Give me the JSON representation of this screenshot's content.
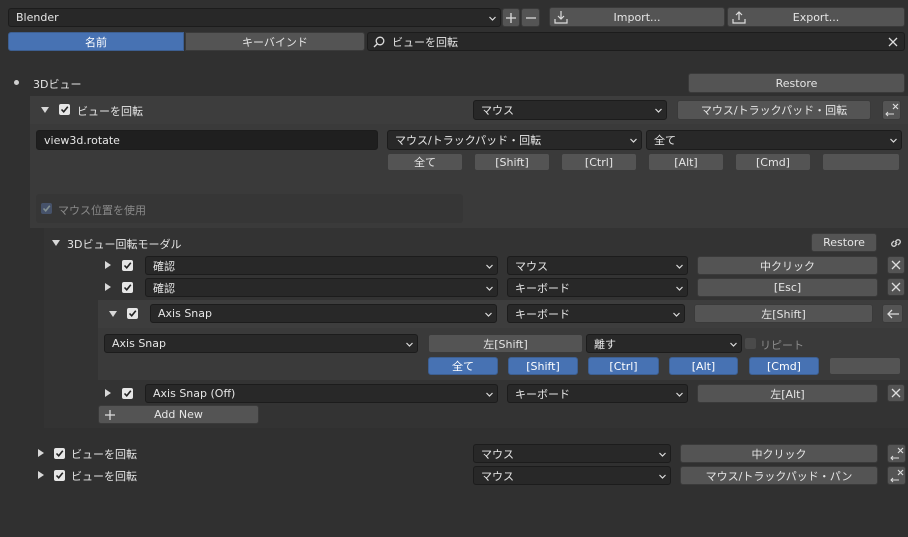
{
  "header": {
    "preset_value": "Blender",
    "import_label": "Import...",
    "export_label": "Export...",
    "tab_name": "名前",
    "tab_keybind": "キーバインド",
    "search_value": "ビューを回転"
  },
  "section": {
    "title": "3Dビュー",
    "restore_label": "Restore"
  },
  "item1": {
    "label": "ビューを回転",
    "type": "マウス",
    "event": "マウス/トラックパッド・回転",
    "operator_id": "view3d.rotate",
    "event_dropdown": "マウス/トラックパッド・回転",
    "any_dropdown": "全て",
    "mods": [
      "全て",
      "[Shift]",
      "[Ctrl]",
      "[Alt]",
      "[Cmd]",
      ""
    ],
    "use_mouse_position": "マウス位置を使用"
  },
  "modal": {
    "title": "3Dビュー回転モーダル",
    "restore_label": "Restore",
    "rows": [
      {
        "name": "確認",
        "type": "マウス",
        "key": "中クリック"
      },
      {
        "name": "確認",
        "type": "キーボード",
        "key": "[Esc]"
      },
      {
        "name": "Axis Snap",
        "type": "キーボード",
        "key": "左[Shift]"
      }
    ],
    "expanded": {
      "name_dropdown": "Axis Snap",
      "key_field": "左[Shift]",
      "value_dropdown": "離す",
      "repeat_label": "リピート",
      "mods": [
        "全て",
        "[Shift]",
        "[Ctrl]",
        "[Alt]",
        "[Cmd]",
        ""
      ]
    },
    "row4": {
      "name": "Axis Snap (Off)",
      "type": "キーボード",
      "key": "左[Alt]"
    },
    "add_new_label": "Add New"
  },
  "items_bottom": [
    {
      "label": "ビューを回転",
      "type": "マウス",
      "event": "中クリック"
    },
    {
      "label": "ビューを回転",
      "type": "マウス",
      "event": "マウス/トラックパッド・パン"
    }
  ],
  "colors": {
    "background": "#303030",
    "button": "#545454",
    "field": "#282828",
    "accent_blue": "#4772b3"
  }
}
